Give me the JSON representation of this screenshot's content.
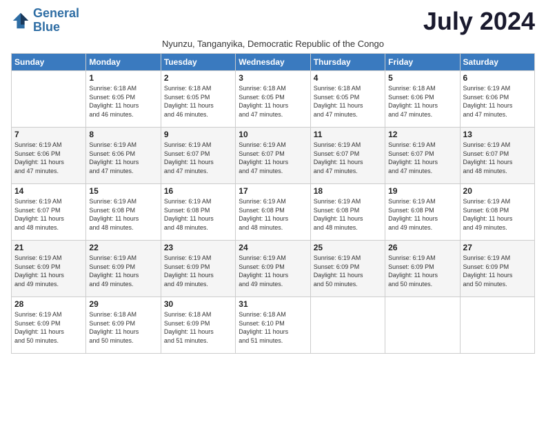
{
  "logo": {
    "line1": "General",
    "line2": "Blue"
  },
  "month_title": "July 2024",
  "subtitle": "Nyunzu, Tanganyika, Democratic Republic of the Congo",
  "days_of_week": [
    "Sunday",
    "Monday",
    "Tuesday",
    "Wednesday",
    "Thursday",
    "Friday",
    "Saturday"
  ],
  "weeks": [
    [
      {
        "day": "",
        "info": ""
      },
      {
        "day": "1",
        "info": "Sunrise: 6:18 AM\nSunset: 6:05 PM\nDaylight: 11 hours\nand 46 minutes."
      },
      {
        "day": "2",
        "info": "Sunrise: 6:18 AM\nSunset: 6:05 PM\nDaylight: 11 hours\nand 46 minutes."
      },
      {
        "day": "3",
        "info": "Sunrise: 6:18 AM\nSunset: 6:05 PM\nDaylight: 11 hours\nand 47 minutes."
      },
      {
        "day": "4",
        "info": "Sunrise: 6:18 AM\nSunset: 6:05 PM\nDaylight: 11 hours\nand 47 minutes."
      },
      {
        "day": "5",
        "info": "Sunrise: 6:18 AM\nSunset: 6:06 PM\nDaylight: 11 hours\nand 47 minutes."
      },
      {
        "day": "6",
        "info": "Sunrise: 6:19 AM\nSunset: 6:06 PM\nDaylight: 11 hours\nand 47 minutes."
      }
    ],
    [
      {
        "day": "7",
        "info": "Sunrise: 6:19 AM\nSunset: 6:06 PM\nDaylight: 11 hours\nand 47 minutes."
      },
      {
        "day": "8",
        "info": "Sunrise: 6:19 AM\nSunset: 6:06 PM\nDaylight: 11 hours\nand 47 minutes."
      },
      {
        "day": "9",
        "info": "Sunrise: 6:19 AM\nSunset: 6:07 PM\nDaylight: 11 hours\nand 47 minutes."
      },
      {
        "day": "10",
        "info": "Sunrise: 6:19 AM\nSunset: 6:07 PM\nDaylight: 11 hours\nand 47 minutes."
      },
      {
        "day": "11",
        "info": "Sunrise: 6:19 AM\nSunset: 6:07 PM\nDaylight: 11 hours\nand 47 minutes."
      },
      {
        "day": "12",
        "info": "Sunrise: 6:19 AM\nSunset: 6:07 PM\nDaylight: 11 hours\nand 47 minutes."
      },
      {
        "day": "13",
        "info": "Sunrise: 6:19 AM\nSunset: 6:07 PM\nDaylight: 11 hours\nand 48 minutes."
      }
    ],
    [
      {
        "day": "14",
        "info": "Sunrise: 6:19 AM\nSunset: 6:07 PM\nDaylight: 11 hours\nand 48 minutes."
      },
      {
        "day": "15",
        "info": "Sunrise: 6:19 AM\nSunset: 6:08 PM\nDaylight: 11 hours\nand 48 minutes."
      },
      {
        "day": "16",
        "info": "Sunrise: 6:19 AM\nSunset: 6:08 PM\nDaylight: 11 hours\nand 48 minutes."
      },
      {
        "day": "17",
        "info": "Sunrise: 6:19 AM\nSunset: 6:08 PM\nDaylight: 11 hours\nand 48 minutes."
      },
      {
        "day": "18",
        "info": "Sunrise: 6:19 AM\nSunset: 6:08 PM\nDaylight: 11 hours\nand 48 minutes."
      },
      {
        "day": "19",
        "info": "Sunrise: 6:19 AM\nSunset: 6:08 PM\nDaylight: 11 hours\nand 49 minutes."
      },
      {
        "day": "20",
        "info": "Sunrise: 6:19 AM\nSunset: 6:08 PM\nDaylight: 11 hours\nand 49 minutes."
      }
    ],
    [
      {
        "day": "21",
        "info": "Sunrise: 6:19 AM\nSunset: 6:09 PM\nDaylight: 11 hours\nand 49 minutes."
      },
      {
        "day": "22",
        "info": "Sunrise: 6:19 AM\nSunset: 6:09 PM\nDaylight: 11 hours\nand 49 minutes."
      },
      {
        "day": "23",
        "info": "Sunrise: 6:19 AM\nSunset: 6:09 PM\nDaylight: 11 hours\nand 49 minutes."
      },
      {
        "day": "24",
        "info": "Sunrise: 6:19 AM\nSunset: 6:09 PM\nDaylight: 11 hours\nand 49 minutes."
      },
      {
        "day": "25",
        "info": "Sunrise: 6:19 AM\nSunset: 6:09 PM\nDaylight: 11 hours\nand 50 minutes."
      },
      {
        "day": "26",
        "info": "Sunrise: 6:19 AM\nSunset: 6:09 PM\nDaylight: 11 hours\nand 50 minutes."
      },
      {
        "day": "27",
        "info": "Sunrise: 6:19 AM\nSunset: 6:09 PM\nDaylight: 11 hours\nand 50 minutes."
      }
    ],
    [
      {
        "day": "28",
        "info": "Sunrise: 6:19 AM\nSunset: 6:09 PM\nDaylight: 11 hours\nand 50 minutes."
      },
      {
        "day": "29",
        "info": "Sunrise: 6:18 AM\nSunset: 6:09 PM\nDaylight: 11 hours\nand 50 minutes."
      },
      {
        "day": "30",
        "info": "Sunrise: 6:18 AM\nSunset: 6:09 PM\nDaylight: 11 hours\nand 51 minutes."
      },
      {
        "day": "31",
        "info": "Sunrise: 6:18 AM\nSunset: 6:10 PM\nDaylight: 11 hours\nand 51 minutes."
      },
      {
        "day": "",
        "info": ""
      },
      {
        "day": "",
        "info": ""
      },
      {
        "day": "",
        "info": ""
      }
    ]
  ]
}
